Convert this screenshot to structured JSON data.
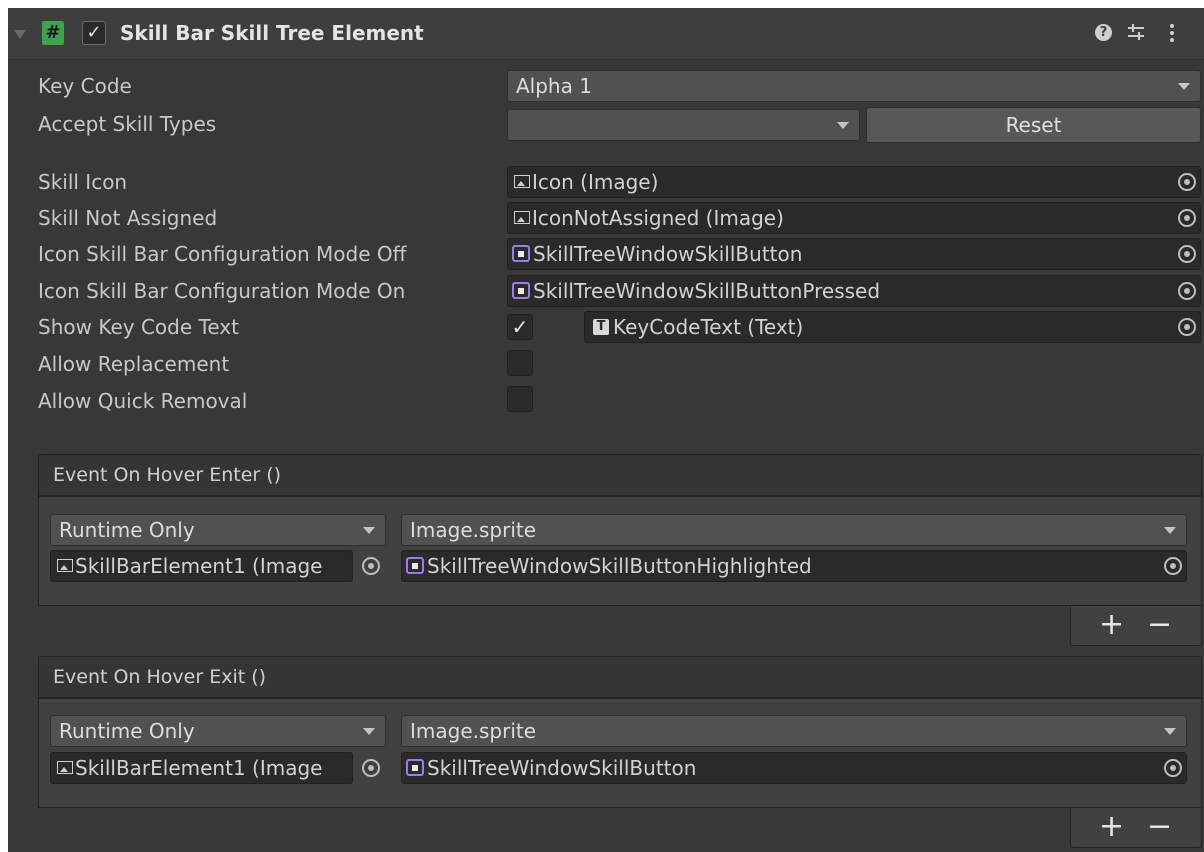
{
  "component": {
    "title": "Skill Bar Skill Tree Element",
    "enabled_check": "✓",
    "script_glyph": "#"
  },
  "fields": {
    "key_code": {
      "label": "Key Code",
      "value": "Alpha 1"
    },
    "accept_skill_types": {
      "label": "Accept Skill Types",
      "value": "",
      "reset_label": "Reset"
    },
    "skill_icon": {
      "label": "Skill Icon",
      "value": "Icon (Image)"
    },
    "skill_not_assigned": {
      "label": "Skill Not Assigned",
      "value": "IconNotAssigned (Image)"
    },
    "icon_off": {
      "label": "Icon Skill Bar Configuration Mode Off",
      "value": "SkillTreeWindowSkillButton"
    },
    "icon_on": {
      "label": "Icon Skill Bar Configuration Mode On",
      "value": "SkillTreeWindowSkillButtonPressed"
    },
    "show_key_code_text": {
      "label": "Show Key Code Text",
      "checked": "✓",
      "value": "KeyCodeText (Text)",
      "text_glyph": "T"
    },
    "allow_replacement": {
      "label": "Allow Replacement",
      "checked": false
    },
    "allow_quick_removal": {
      "label": "Allow Quick Removal",
      "checked": false
    }
  },
  "events": [
    {
      "title": "Event On Hover Enter ()",
      "runtime": "Runtime Only",
      "function": "Image.sprite",
      "target": "SkillBarElement1 (Image",
      "argument": "SkillTreeWindowSkillButtonHighlighted",
      "add_label": "+",
      "remove_label": "−"
    },
    {
      "title": "Event On Hover Exit ()",
      "runtime": "Runtime Only",
      "function": "Image.sprite",
      "target": "SkillBarElement1 (Image",
      "argument": "SkillTreeWindowSkillButton",
      "add_label": "+",
      "remove_label": "−"
    }
  ],
  "header_icons": [
    "help-icon",
    "settings-sliders-icon",
    "kebab-menu-icon"
  ],
  "colors": {
    "panel_bg": "#383838",
    "field_bg": "#2a2a2a",
    "dropdown_bg": "#515151",
    "script_icon_green": "#3fa34d",
    "sprite_icon_purple": "#9b7cf0"
  }
}
